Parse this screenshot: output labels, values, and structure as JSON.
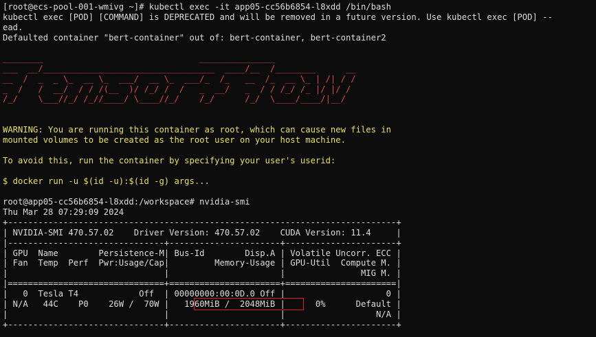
{
  "theme": {
    "background": "#0c0c0c",
    "text": "#dcdcdc",
    "banner": "#e04848",
    "warning": "#e8e05a",
    "highlight": "#e02020"
  },
  "terminal": {
    "lines": [
      {
        "text": "[root@ecs-pool-001-wmivg ~]# kubectl exec -it app05-cc56b6854-l8xdd /bin/bash",
        "color": "white"
      },
      {
        "text": "kubectl exec [POD] [COMMAND] is DEPRECATED and will be removed in a future version. Use kubectl exec [POD] --",
        "color": "white"
      },
      {
        "text": "ead.",
        "color": "white"
      },
      {
        "text": "Defaulted container \"bert-container\" out of: bert-container, bert-container2",
        "color": "white"
      },
      {
        "text": "",
        "color": "white"
      },
      {
        "text": "________                               _______________",
        "color": "red"
      },
      {
        "text": "___  __/__________________________________  ____/__  /________      __",
        "color": "red"
      },
      {
        "text": "__  /  _  _ \\_  __ \\_  ___/  __ \\_  ___/_  /_   __  /_  __ \\_ | /| / /",
        "color": "red"
      },
      {
        "text": "_  /   /  __/  / / /(__  )/ /_/ /  /   _  __/   _  / / /_/ /_ |/ |/ /",
        "color": "red"
      },
      {
        "text": "/_/    \\___//_/ /_//____/ \\____//_/    /_/      /_/  \\____/____/|__/",
        "color": "red"
      },
      {
        "text": "",
        "color": "white"
      },
      {
        "text": "",
        "color": "white"
      },
      {
        "text": "WARNING: You are running this container as root, which can cause new files in",
        "color": "yellow"
      },
      {
        "text": "mounted volumes to be created as the root user on your host machine.",
        "color": "yellow"
      },
      {
        "text": "",
        "color": "white"
      },
      {
        "text": "To avoid this, run the container by specifying your user's userid:",
        "color": "yellow"
      },
      {
        "text": "",
        "color": "white"
      },
      {
        "text": "$ docker run -u $(id -u):$(id -g) args...",
        "color": "yellow"
      },
      {
        "text": "",
        "color": "white"
      },
      {
        "text": "root@app05-cc56b6854-l8xdd:/workspace# nvidia-smi",
        "color": "white"
      },
      {
        "text": "Thu Mar 28 07:29:09 2024",
        "color": "white"
      },
      {
        "text": "+-----------------------------------------------------------------------------+",
        "color": "white"
      },
      {
        "text": "| NVIDIA-SMI 470.57.02    Driver Version: 470.57.02    CUDA Version: 11.4     |",
        "color": "white"
      },
      {
        "text": "|-------------------------------+----------------------+----------------------+",
        "color": "white"
      },
      {
        "text": "| GPU  Name        Persistence-M| Bus-Id        Disp.A | Volatile Uncorr. ECC |",
        "color": "white"
      },
      {
        "text": "| Fan  Temp  Perf  Pwr:Usage/Cap|         Memory-Usage | GPU-Util  Compute M. |",
        "color": "white"
      },
      {
        "text": "|                               |                      |               MIG M. |",
        "color": "white"
      },
      {
        "text": "|===============================+======================+======================|",
        "color": "white"
      },
      {
        "text": "|   0  Tesla T4            Off  | 00000000:00:0D.0 Off |                    0 |",
        "color": "white"
      },
      {
        "text": "| N/A   44C    P0    26W /  70W |   1960MiB /  2048MiB |      0%      Default |",
        "color": "white"
      },
      {
        "text": "|                               |                      |                  N/A |",
        "color": "white"
      },
      {
        "text": "+-------------------------------+----------------------+----------------------+",
        "color": "white"
      }
    ]
  }
}
